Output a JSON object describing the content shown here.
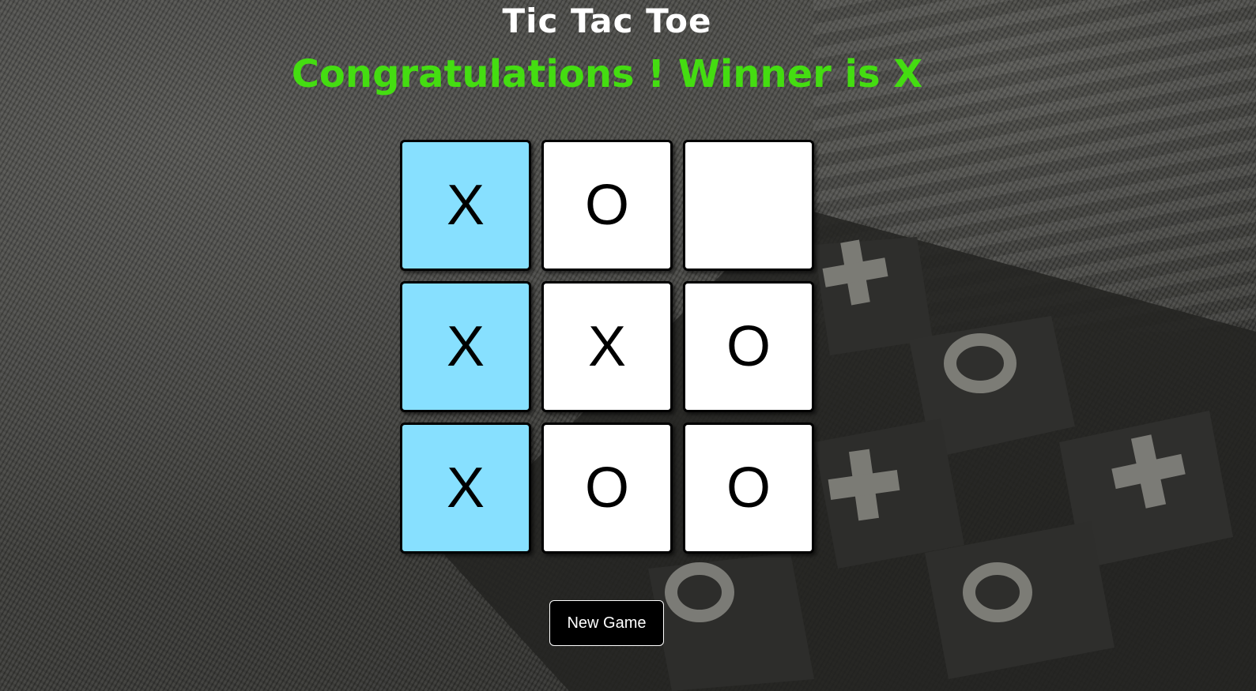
{
  "title": "Tic Tac Toe",
  "status": "Congratulations ! Winner is X",
  "colors": {
    "status_text": "#44dd11",
    "winning_cell": "#87e0ff",
    "cell": "#ffffff",
    "button_bg": "#000000"
  },
  "board": {
    "cells": [
      {
        "value": "X",
        "winning": true
      },
      {
        "value": "O",
        "winning": false
      },
      {
        "value": "",
        "winning": false
      },
      {
        "value": "X",
        "winning": true
      },
      {
        "value": "X",
        "winning": false
      },
      {
        "value": "O",
        "winning": false
      },
      {
        "value": "X",
        "winning": true
      },
      {
        "value": "O",
        "winning": false
      },
      {
        "value": "O",
        "winning": false
      }
    ]
  },
  "new_game_label": "New Game"
}
